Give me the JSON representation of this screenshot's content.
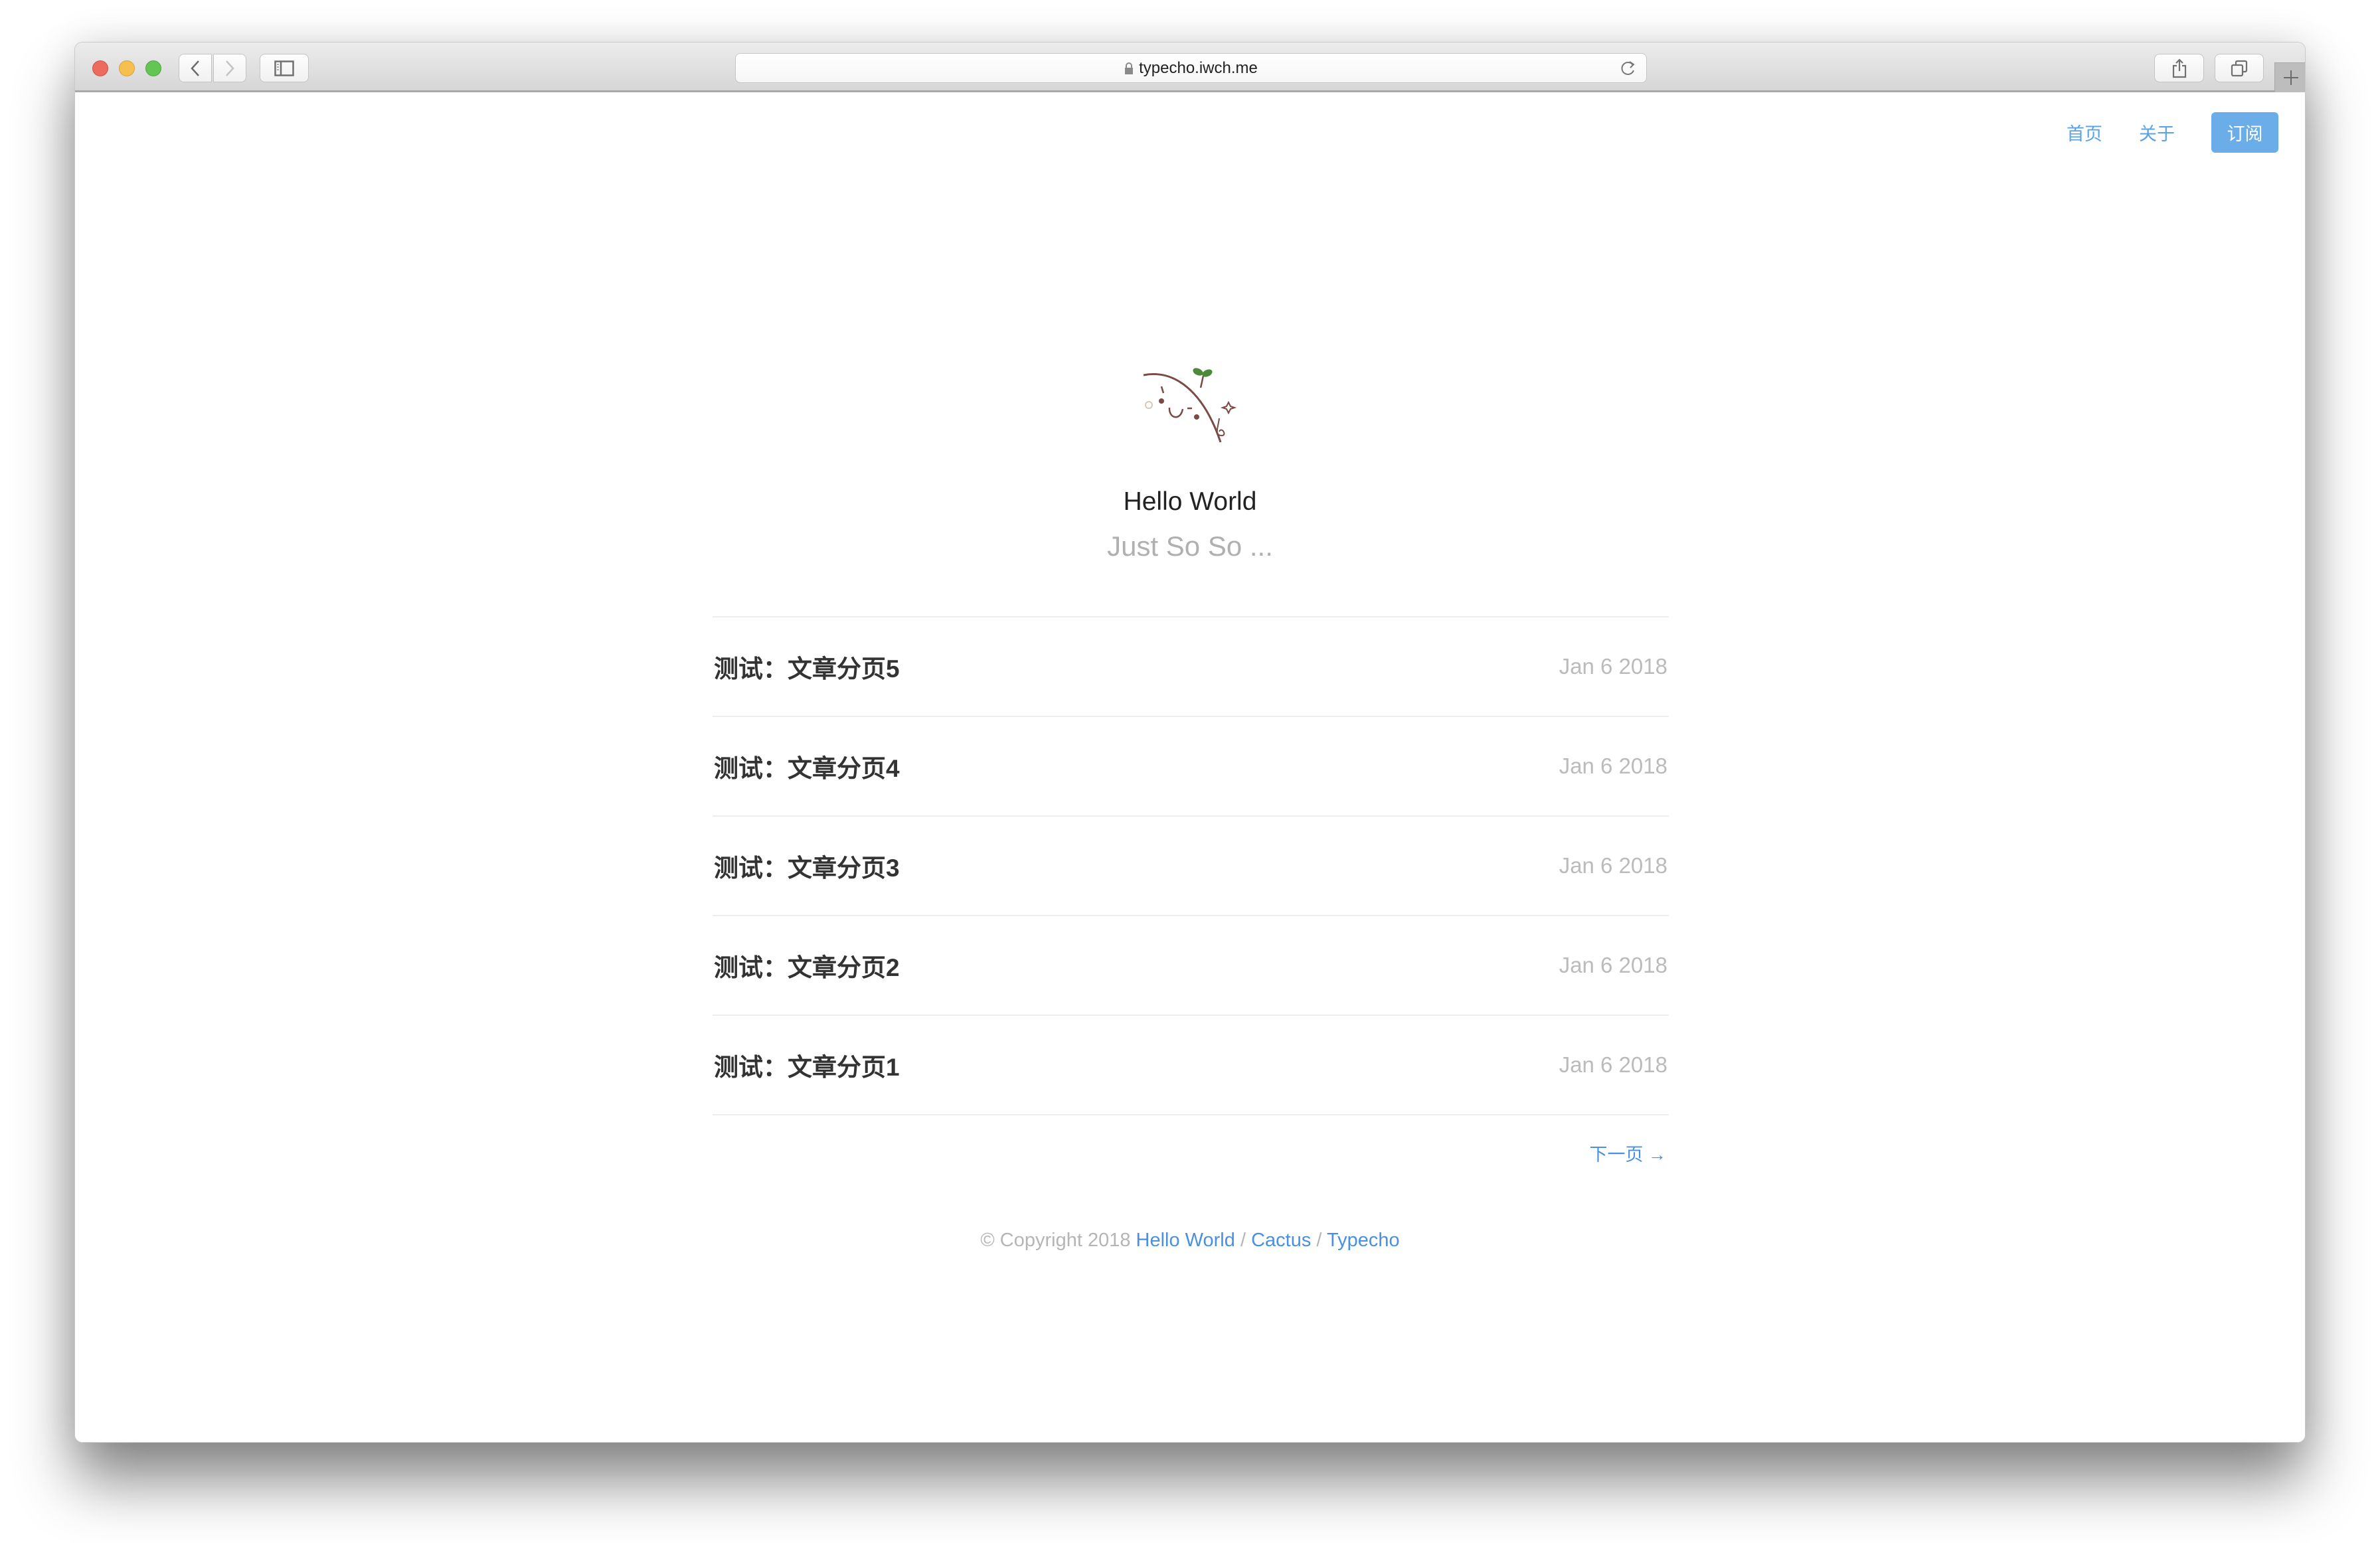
{
  "browser": {
    "url": "typecho.iwch.me",
    "icons": {
      "close": "close-dot",
      "minimize": "minimize-dot",
      "zoom": "zoom-dot",
      "back": "chevron-left-icon",
      "forward": "chevron-right-icon",
      "sidebar": "sidebar-icon",
      "lock": "lock-icon",
      "reload": "reload-icon",
      "share": "share-icon",
      "tabs": "tabs-icon",
      "new_tab": "plus-icon"
    }
  },
  "nav": {
    "items": [
      {
        "label": "首页"
      },
      {
        "label": "关于"
      }
    ],
    "subscribe_label": "订阅"
  },
  "site": {
    "title": "Hello World",
    "description": "Just So So ..."
  },
  "posts": [
    {
      "title": "测试：文章分页5",
      "date": "Jan 6 2018"
    },
    {
      "title": "测试：文章分页4",
      "date": "Jan 6 2018"
    },
    {
      "title": "测试：文章分页3",
      "date": "Jan 6 2018"
    },
    {
      "title": "测试：文章分页2",
      "date": "Jan 6 2018"
    },
    {
      "title": "测试：文章分页1",
      "date": "Jan 6 2018"
    }
  ],
  "pagination": {
    "next_label": "下一页 →"
  },
  "footer": {
    "copyright": "© Copyright 2018",
    "links": [
      {
        "label": "Hello World"
      },
      {
        "label": "Cactus"
      },
      {
        "label": "Typecho"
      }
    ],
    "separator": "/"
  },
  "colors": {
    "accent": "#4a90e2",
    "nav_link": "#5aa2e6",
    "subscribe_bg": "#6aade8",
    "title": "#222222",
    "muted": "#bbbbbb"
  }
}
